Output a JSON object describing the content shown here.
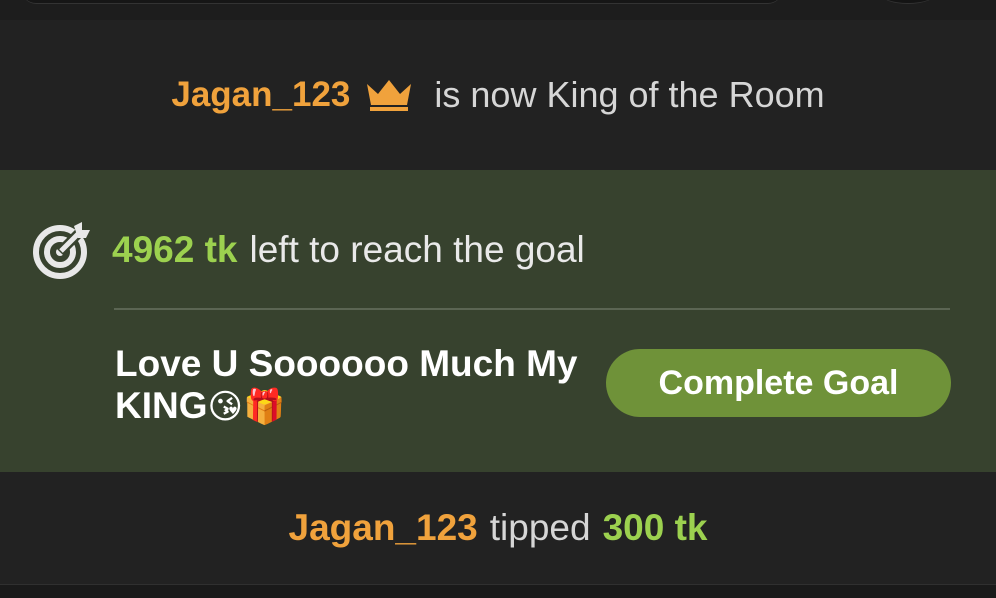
{
  "king_notice": {
    "username": "Jagan_123",
    "icon": "crown-icon",
    "message": "is now King of the Room"
  },
  "goal": {
    "icon": "target-icon",
    "amount": "4962 tk",
    "message": "left to reach the goal",
    "title": "Love U Soooooo Much My KING",
    "title_emojis": "😘🎁",
    "button_label": "Complete Goal"
  },
  "tip": {
    "username": "Jagan_123",
    "verb": "tipped",
    "amount": "300 tk"
  },
  "colors": {
    "username": "#f0a23c",
    "token_amount": "#9cd14f",
    "goal_panel_bg": "#37422e",
    "button_bg": "#6f9239"
  }
}
